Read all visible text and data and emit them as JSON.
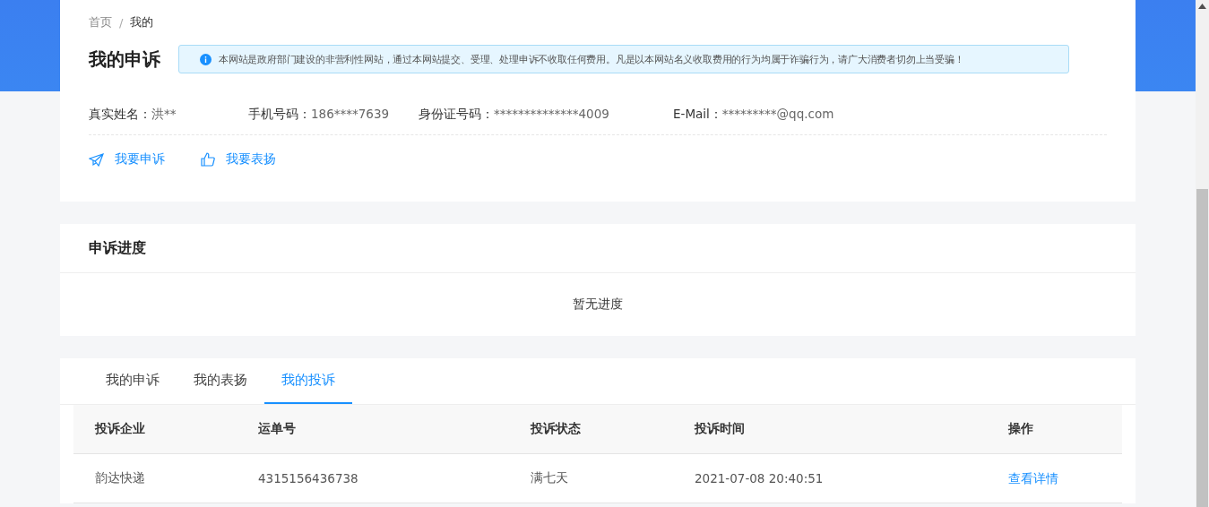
{
  "breadcrumb": [
    {
      "label": "首页"
    },
    {
      "label": "我的"
    }
  ],
  "breadcrumb_separator": "/",
  "page_title": "我的申诉",
  "notice": "本网站是政府部门建设的非营利性网站，通过本网站提交、受理、处理申诉不收取任何费用。凡是以本网站名义收取费用的行为均属于诈骗行为，请广大消费者切勿上当受骗！",
  "profile": [
    {
      "label": "真实姓名：",
      "value": "洪**"
    },
    {
      "label": "手机号码：",
      "value": "186****7639"
    },
    {
      "label": "身份证号码：",
      "value": "**************4009"
    },
    {
      "label": "E-Mail：",
      "value": "*********@qq.com"
    }
  ],
  "actions": [
    {
      "kind": "complain",
      "label": "我要申诉"
    },
    {
      "kind": "praise",
      "label": "我要表扬"
    }
  ],
  "progress": {
    "title": "申诉进度",
    "empty": "暂无进度"
  },
  "tabs": [
    {
      "label": "我的申诉",
      "selected": false
    },
    {
      "label": "我的表扬",
      "selected": false
    },
    {
      "label": "我的投诉",
      "selected": true
    }
  ],
  "table": {
    "columns": [
      "投诉企业",
      "运单号",
      "投诉状态",
      "投诉时间",
      "操作"
    ],
    "rows": [
      {
        "cells": [
          "韵达快递",
          "4315156436738",
          "满七天",
          "2021-07-08 20:40:51"
        ],
        "action": "查看详情"
      }
    ]
  }
}
